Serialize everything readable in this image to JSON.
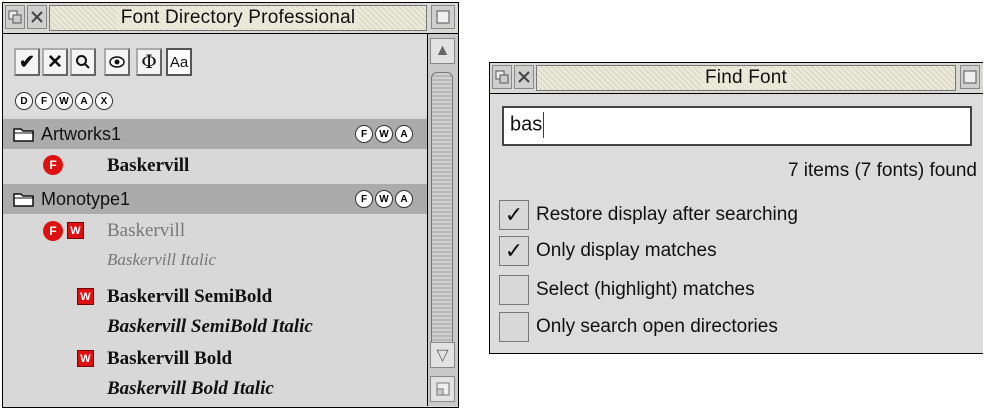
{
  "font_directory": {
    "title": "Font Directory Professional",
    "toolbar": {
      "buttons": [
        {
          "label": "✔",
          "icon": "tick-icon"
        },
        {
          "label": "✕",
          "icon": "cross-icon"
        },
        {
          "label": "Q",
          "icon": "search-icon"
        },
        {
          "label": "◉",
          "icon": "eye-icon"
        },
        {
          "label": "Φ",
          "icon": "phi-icon"
        },
        {
          "label": "Aa",
          "icon": "font-icon"
        }
      ],
      "filters": [
        "D",
        "F",
        "W",
        "A",
        "X"
      ]
    },
    "directories": [
      {
        "name": "Artworks1",
        "badges": [
          "F",
          "W",
          "A"
        ]
      },
      {
        "name": "Monotype1",
        "badges": [
          "F",
          "W",
          "A"
        ]
      }
    ],
    "fonts": [
      {
        "text": "Baskervill",
        "badges": [
          "F"
        ]
      },
      {
        "text": "Baskervill",
        "badges": [
          "F",
          "W"
        ]
      },
      {
        "text": "Baskervill Italic",
        "badges": []
      },
      {
        "text": "Baskervill SemiBold",
        "badges": [
          "W"
        ]
      },
      {
        "text": "Baskervill SemiBold Italic",
        "badges": []
      },
      {
        "text": "Baskervill Bold",
        "badges": [
          "W"
        ]
      },
      {
        "text": "Baskervill Bold Italic",
        "badges": []
      }
    ],
    "scroll_up": "▲",
    "scroll_down": "▽"
  },
  "find_font": {
    "title": "Find Font",
    "search_value": "bas",
    "result_text": "7 items (7 fonts) found",
    "options": [
      {
        "label": "Restore display after searching",
        "checked": true,
        "mark": "✓"
      },
      {
        "label": "Only display matches",
        "checked": true,
        "mark": "✓"
      },
      {
        "label": "Select (highlight) matches",
        "checked": false,
        "mark": ""
      },
      {
        "label": "Only search open directories",
        "checked": false,
        "mark": ""
      }
    ]
  }
}
